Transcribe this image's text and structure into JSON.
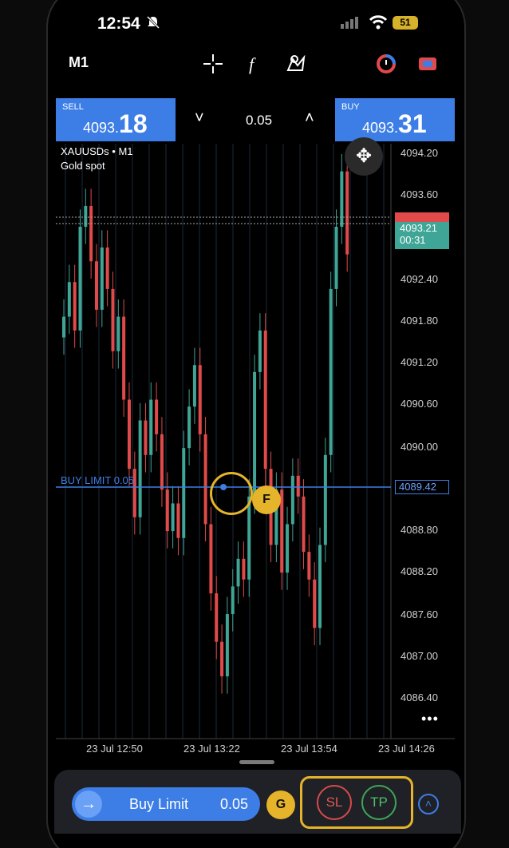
{
  "status": {
    "time": "12:54",
    "battery": "51"
  },
  "toolbar": {
    "timeframe": "M1",
    "icons": [
      "crosshair-icon",
      "indicators-icon",
      "objects-icon",
      "cycle-icon",
      "trade-icon"
    ]
  },
  "trade": {
    "sell_label": "SELL",
    "sell_price_small": "4093.",
    "sell_price_big": "18",
    "buy_label": "BUY",
    "buy_price_small": "4093.",
    "buy_price_big": "31",
    "lot": "0.05",
    "lot_down": "˅",
    "lot_up": "˄"
  },
  "chart": {
    "symbol": "XAUUSDs • M1",
    "description": "Gold spot",
    "price_ticks": [
      "4094.20",
      "4093.60",
      "4092.40",
      "4091.80",
      "4091.20",
      "4090.60",
      "4090.00",
      "4088.80",
      "4088.20",
      "4087.60",
      "4087.00",
      "4086.40"
    ],
    "time_ticks": [
      "23 Jul 12:50",
      "23 Jul 13:22",
      "23 Jul 13:54",
      "23 Jul 14:26"
    ],
    "current_bid_tag": "4093.21",
    "countdown": "00:31",
    "buy_limit_label": "BUY LIMIT 0.05",
    "buy_limit_price": "4089.42",
    "more": "•••"
  },
  "chart_data": {
    "type": "candlestick",
    "y_range": [
      4086.0,
      4094.6
    ],
    "colors": {
      "up": "#3fa596",
      "down": "#e04a4a",
      "grid": "#1c2a3a"
    }
  },
  "annotations": {
    "f": "F",
    "g": "G"
  },
  "order_panel": {
    "order_type": "Buy Limit",
    "volume": "0.05",
    "sl": "SL",
    "tp": "TP"
  }
}
